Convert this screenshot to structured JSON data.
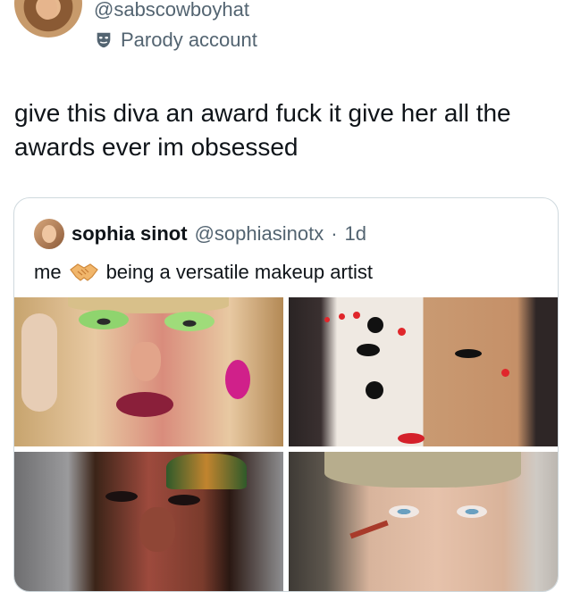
{
  "author": {
    "handle": "@sabscowboyhat",
    "label": "Parody account"
  },
  "tweet": {
    "text": "give this diva an award fuck it give her all the awards ever im obsessed"
  },
  "quoted_tweet": {
    "name": "sophia sinot",
    "handle": "@sophiasinotx",
    "separator": "·",
    "time": "1d",
    "text_before": "me",
    "text_after": "being a versatile makeup artist"
  },
  "colors": {
    "text_primary": "#0f1419",
    "text_secondary": "#536471",
    "border": "#cfd9de"
  },
  "icons": {
    "parody": "theater-mask-icon",
    "emoji": "handshake-icon"
  }
}
